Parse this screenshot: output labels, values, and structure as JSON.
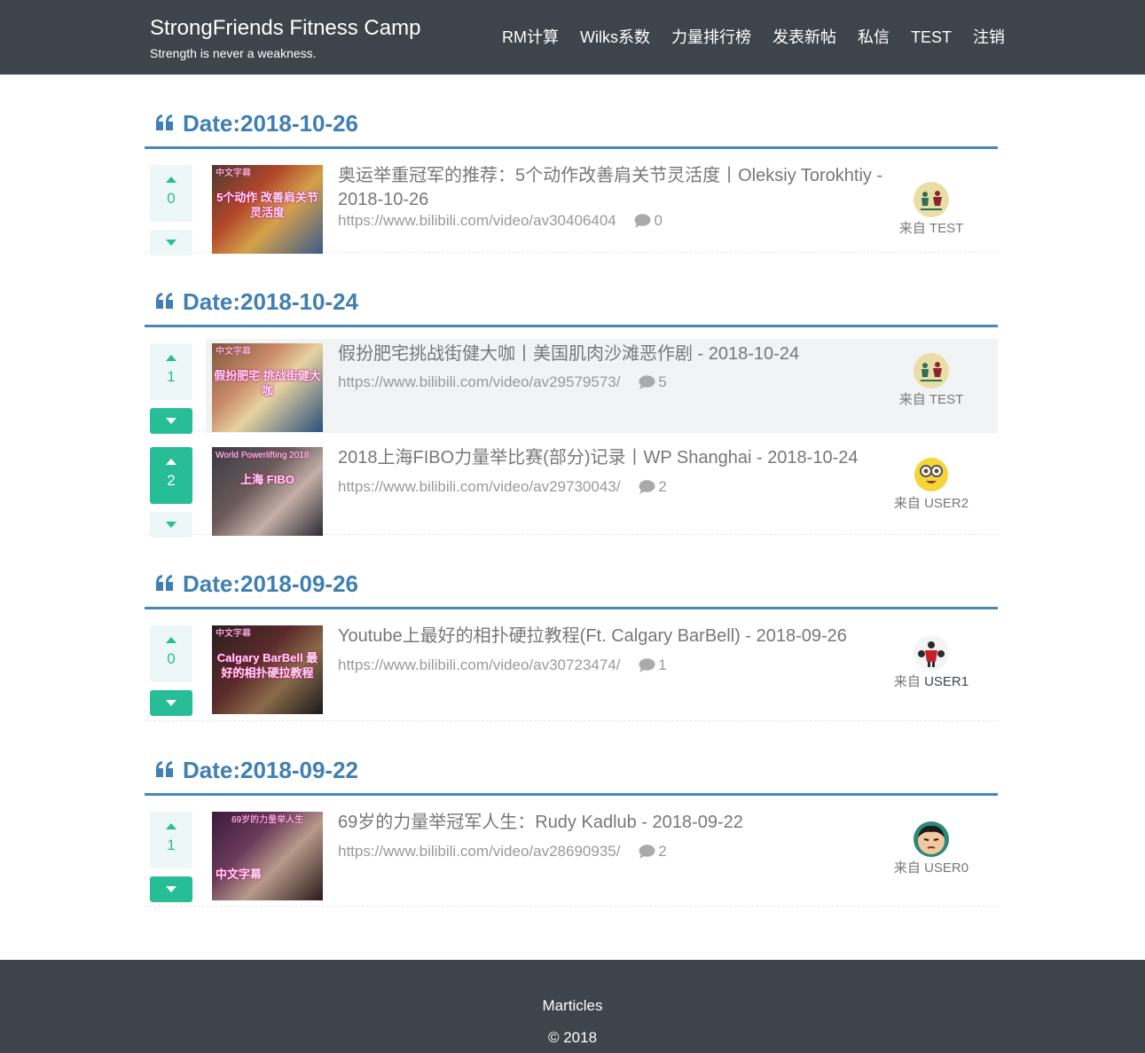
{
  "header": {
    "brand_title": "StrongFriends Fitness Camp",
    "brand_subtitle": "Strength is never a weakness.",
    "nav": [
      "RM计算",
      "Wilks系数",
      "力量排行榜",
      "发表新帖",
      "私信",
      "TEST",
      "注销"
    ]
  },
  "author_prefix": "来自",
  "sections": [
    {
      "date": "Date:2018-10-26",
      "posts": [
        {
          "votes": "0",
          "thumb_tag": "中文字幕",
          "thumb_text": "5个动作 改善肩关节 灵活度",
          "title": "奥运举重冠军的推荐：5个动作改善肩关节灵活度丨Oleksiy Torokhtiy - 2018-10-26",
          "url": "https://www.bilibili.com/video/av30406404",
          "comments": "0",
          "author": "TEST"
        }
      ]
    },
    {
      "date": "Date:2018-10-24",
      "posts": [
        {
          "votes": "1",
          "thumb_tag": "中文字幕",
          "thumb_text": "假扮肥宅 挑战街健大咖",
          "title": "假扮肥宅挑战街健大咖丨美国肌肉沙滩恶作剧 - 2018-10-24",
          "url": "https://www.bilibili.com/video/av29579573/",
          "comments": "5",
          "author": "TEST"
        },
        {
          "votes": "2",
          "thumb_tag": "World Powerlifting 2018",
          "thumb_text": "上海 FIBO",
          "title": "2018上海FIBO力量举比赛(部分)记录丨WP Shanghai - 2018-10-24",
          "url": "https://www.bilibili.com/video/av29730043/",
          "comments": "2",
          "author": "USER2"
        }
      ]
    },
    {
      "date": "Date:2018-09-26",
      "posts": [
        {
          "votes": "0",
          "thumb_tag": "中文字幕",
          "thumb_text": "Calgary BarBell 最好的相扑硬拉教程",
          "title": "Youtube上最好的相扑硬拉教程(Ft. Calgary BarBell) - 2018-09-26",
          "url": "https://www.bilibili.com/video/av30723474/",
          "comments": "1",
          "author": "USER1"
        }
      ]
    },
    {
      "date": "Date:2018-09-22",
      "posts": [
        {
          "votes": "1",
          "thumb_tag": "69岁的力量举人生",
          "thumb_text": "中文字幕",
          "title": "69岁的力量举冠军人生：Rudy Kadlub - 2018-09-22",
          "url": "https://www.bilibili.com/video/av28690935/",
          "comments": "2",
          "author": "USER0"
        }
      ]
    }
  ],
  "footer": {
    "title": "Marticles",
    "copyright": "© 2018"
  },
  "colors": {
    "header_bg": "#3e444b",
    "accent_blue": "#3f7fb3",
    "vote_green": "#27bd97",
    "vote_bg": "#eef7f7",
    "highlight_bg": "#f2f3f4"
  },
  "icons": {
    "section_marker": "quote-left-icon",
    "upvote": "triangle-up-icon",
    "downvote": "triangle-down-icon",
    "comments": "comment-bubble-icon"
  }
}
